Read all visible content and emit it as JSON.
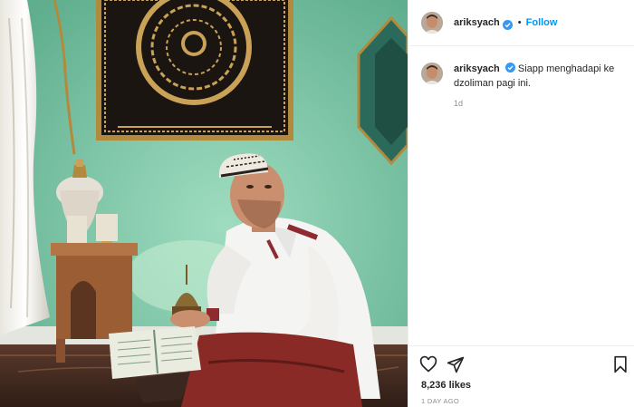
{
  "post": {
    "username": "ariksyach",
    "follow_label": "Follow",
    "separator": "•",
    "caption": "Siapp menghadapi ke dzoliman pagi ini.",
    "comment_time": "1d",
    "likes": "8,236 likes",
    "time_ago": "1 DAY AGO"
  },
  "icons": {
    "verified": "verified-badge-icon",
    "like": "heart-icon",
    "share": "paper-plane-icon",
    "save": "bookmark-icon"
  },
  "colors": {
    "follow_blue": "#0095f6",
    "verified_blue": "#3897f0",
    "muted_text": "#8e8e8e",
    "wall_green": "#7fc7a8",
    "divider": "#efefef"
  }
}
